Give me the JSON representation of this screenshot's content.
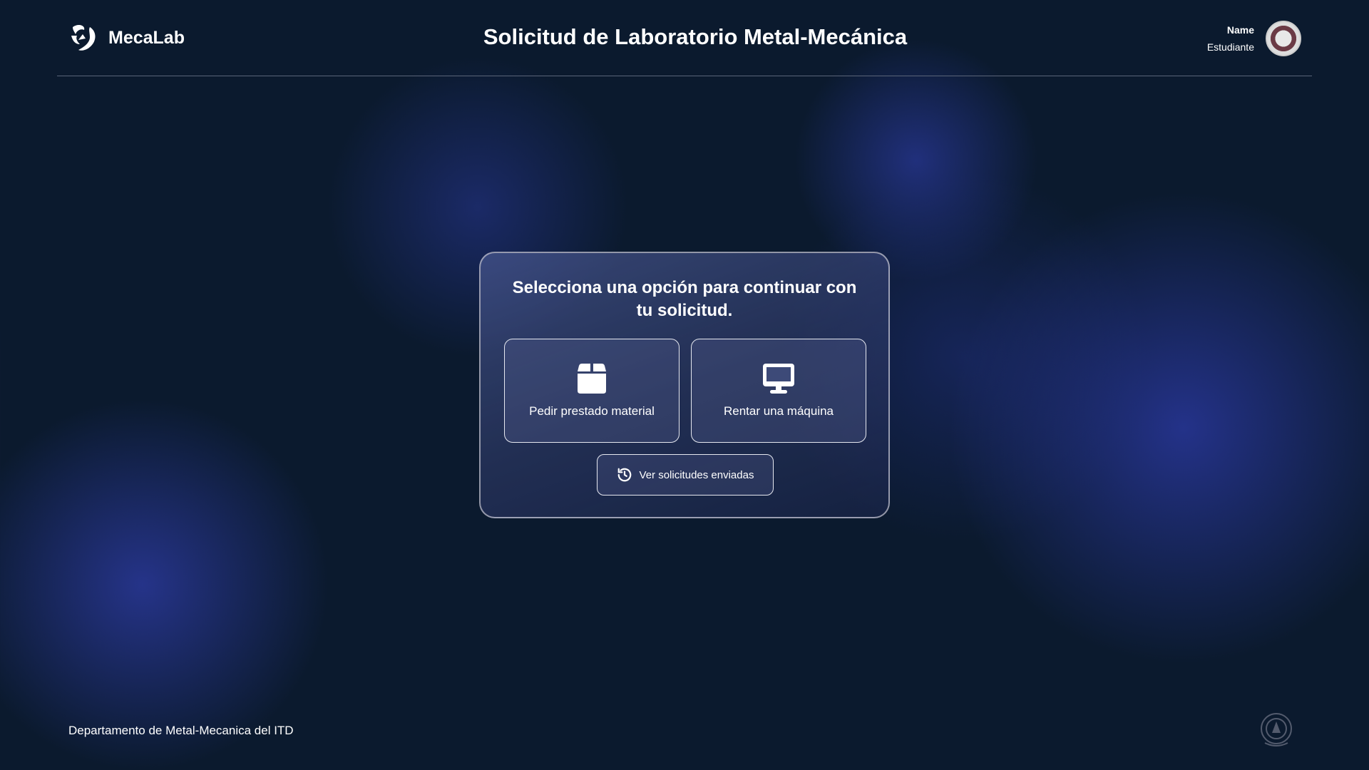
{
  "header": {
    "brand": "MecaLab",
    "title": "Solicitud de Laboratorio Metal-Mecánica",
    "user_name": "Name",
    "user_role": "Estudiante"
  },
  "card": {
    "title": "Selecciona una opción para continuar con tu solicitud.",
    "options": [
      {
        "label": "Pedir prestado material",
        "icon": "box-icon"
      },
      {
        "label": "Rentar una máquina",
        "icon": "monitor-icon"
      }
    ],
    "history_label": "Ver solicitudes enviadas"
  },
  "footer": {
    "text": "Departamento de Metal-Mecanica del ITD"
  }
}
